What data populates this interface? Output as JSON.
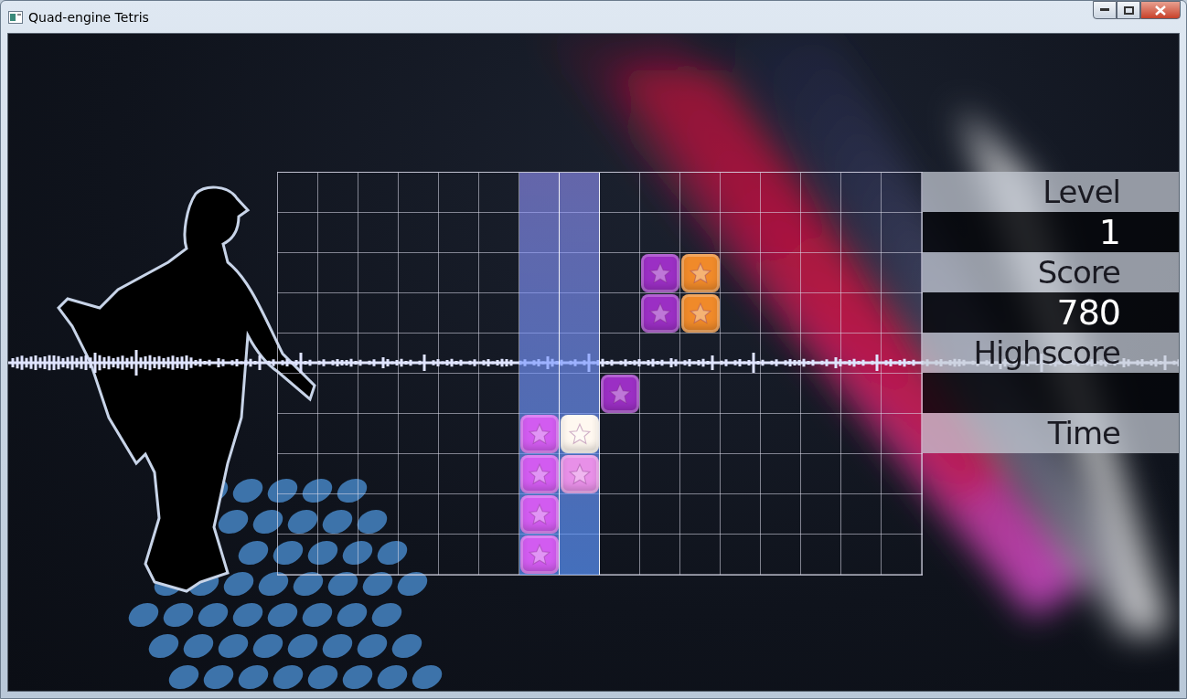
{
  "window": {
    "title": "Quad-engine Tetris"
  },
  "board": {
    "columns": [
      {
        "highlighted": false
      },
      {
        "highlighted": false
      },
      {
        "highlighted": false
      },
      {
        "highlighted": false
      },
      {
        "highlighted": false
      },
      {
        "highlighted": false
      },
      {
        "highlighted": true
      },
      {
        "highlighted": true
      },
      {
        "highlighted": false
      },
      {
        "highlighted": false
      },
      {
        "highlighted": false
      },
      {
        "highlighted": false
      },
      {
        "highlighted": false
      },
      {
        "highlighted": false
      },
      {
        "highlighted": false
      },
      {
        "highlighted": false
      }
    ],
    "rows": [
      {
        "cells": [
          null,
          null,
          null,
          null,
          null,
          null,
          null,
          null,
          null,
          null,
          null,
          null,
          null,
          null,
          null,
          null
        ]
      },
      {
        "cells": [
          null,
          null,
          null,
          null,
          null,
          null,
          null,
          null,
          null,
          null,
          null,
          null,
          null,
          null,
          null,
          null
        ]
      },
      {
        "cells": [
          null,
          null,
          null,
          null,
          null,
          null,
          null,
          null,
          null,
          {
            "color": "#9b2fc4"
          },
          {
            "color": "#f08a2a"
          },
          null,
          null,
          null,
          null,
          null
        ]
      },
      {
        "cells": [
          null,
          null,
          null,
          null,
          null,
          null,
          null,
          null,
          null,
          {
            "color": "#9b2fc4"
          },
          {
            "color": "#f08a2a"
          },
          null,
          null,
          null,
          null,
          null
        ]
      },
      {
        "cells": [
          null,
          null,
          null,
          null,
          null,
          null,
          null,
          null,
          null,
          null,
          null,
          null,
          null,
          null,
          null,
          null
        ]
      },
      {
        "cells": [
          null,
          null,
          null,
          null,
          null,
          null,
          null,
          null,
          {
            "color": "#9b2fc4"
          },
          null,
          null,
          null,
          null,
          null,
          null,
          null
        ]
      },
      {
        "cells": [
          null,
          null,
          null,
          null,
          null,
          null,
          {
            "color": "#d25cf0"
          },
          {
            "color": "#fff8f0"
          },
          null,
          null,
          null,
          null,
          null,
          null,
          null,
          null
        ]
      },
      {
        "cells": [
          null,
          null,
          null,
          null,
          null,
          null,
          {
            "color": "#d25cf0"
          },
          {
            "color": "#e890e8"
          },
          null,
          null,
          null,
          null,
          null,
          null,
          null,
          null
        ]
      },
      {
        "cells": [
          null,
          null,
          null,
          null,
          null,
          null,
          {
            "color": "#d25cf0"
          },
          null,
          null,
          null,
          null,
          null,
          null,
          null,
          null,
          null
        ]
      },
      {
        "cells": [
          null,
          null,
          null,
          null,
          null,
          null,
          {
            "color": "#d25cf0"
          },
          null,
          null,
          null,
          null,
          null,
          null,
          null,
          null,
          null
        ]
      }
    ]
  },
  "stats": [
    {
      "label": "Level",
      "value": "1"
    },
    {
      "label": "Score",
      "value": "780"
    },
    {
      "label": "Highscore"
    },
    {
      "label": "Time"
    }
  ]
}
